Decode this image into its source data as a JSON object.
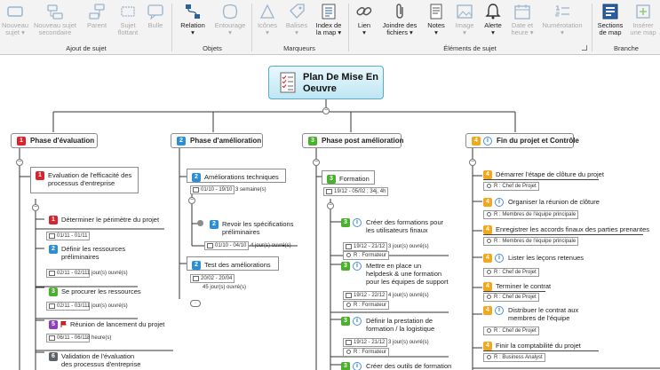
{
  "ribbon": {
    "buttons": [
      {
        "id": "nouveau-sujet",
        "label1": "Nouveau",
        "label2": "sujet ▾",
        "enabled": false,
        "icon": "new-topic-icon"
      },
      {
        "id": "nouveau-sujet-secondaire",
        "label1": "Nouveau sujet",
        "label2": "secondaire",
        "enabled": false,
        "icon": "new-subtopic-icon"
      },
      {
        "id": "parent",
        "label1": "Parent",
        "label2": "",
        "enabled": false,
        "icon": "parent-icon"
      },
      {
        "id": "sujet-flottant",
        "label1": "Sujet",
        "label2": "flottant",
        "enabled": false,
        "icon": "floating-topic-icon"
      },
      {
        "id": "bulle",
        "label1": "Bulle",
        "label2": "",
        "enabled": false,
        "icon": "bubble-icon"
      },
      {
        "id": "relation",
        "label1": "Relation",
        "label2": "▾",
        "enabled": true,
        "icon": "relation-icon"
      },
      {
        "id": "entourage",
        "label1": "Entourage",
        "label2": "▾",
        "enabled": false,
        "icon": "boundary-icon"
      },
      {
        "id": "icones",
        "label1": "Icônes",
        "label2": "▾",
        "enabled": false,
        "icon": "icons-icon"
      },
      {
        "id": "balises",
        "label1": "Balises",
        "label2": "▾",
        "enabled": false,
        "icon": "tags-icon"
      },
      {
        "id": "index-map",
        "label1": "Index de",
        "label2": "la map ▾",
        "enabled": true,
        "icon": "map-index-icon"
      },
      {
        "id": "lien",
        "label1": "Lien",
        "label2": "▾",
        "enabled": true,
        "icon": "link-icon"
      },
      {
        "id": "joindre",
        "label1": "Joindre des",
        "label2": "fichiers ▾",
        "enabled": true,
        "icon": "attach-icon"
      },
      {
        "id": "notes",
        "label1": "Notes",
        "label2": "▾",
        "enabled": true,
        "icon": "notes-icon"
      },
      {
        "id": "image",
        "label1": "Image",
        "label2": "▾",
        "enabled": false,
        "icon": "image-icon"
      },
      {
        "id": "alerte",
        "label1": "Alerte",
        "label2": "▾",
        "enabled": true,
        "icon": "alert-icon"
      },
      {
        "id": "date-heure",
        "label1": "Date et",
        "label2": "heure ▾",
        "enabled": false,
        "icon": "datetime-icon"
      },
      {
        "id": "numerotation",
        "label1": "Numérotation",
        "label2": "▾",
        "enabled": false,
        "icon": "numbering-icon"
      },
      {
        "id": "sections-map",
        "label1": "Sections",
        "label2": "de map",
        "enabled": true,
        "icon": "map-sections-icon"
      },
      {
        "id": "inserer-map",
        "label1": "Insérer",
        "label2": "une map",
        "enabled": false,
        "icon": "insert-map-icon"
      }
    ],
    "groups": {
      "ajout": "Ajout de sujet",
      "objets": "Objets",
      "marqueurs": "Marqueurs",
      "elements": "Éléments de sujet",
      "branche": "Branche"
    },
    "colors": {
      "accent": "#2b5f9e",
      "disabled": "#a9a9a9"
    }
  },
  "map": {
    "root": "Plan De Mise En Oeuvre",
    "phases": [
      {
        "num": "1",
        "title": "Phase d'évaluation",
        "task": {
          "num": "1",
          "text": "Evaluation de l'efficacité des processus d'entreprise"
        },
        "items": [
          {
            "num": "1",
            "text": "Déterminer le périmètre du projet",
            "date": "01/11 - 01/11"
          },
          {
            "num": "2",
            "text": "Définir les ressources préliminaires",
            "date": "02/11 - 02/11",
            "dur": "1 jour(s) ouvré(s)"
          },
          {
            "num": "3",
            "text": "Se procurer les ressources",
            "date": "02/11 - 03/11",
            "dur": "1 jour(s) ouvré(s)"
          },
          {
            "num": "5",
            "text": "Réunion de lancement du projet",
            "date": "06/11 - 06/11",
            "dur": "8 heure(s)"
          },
          {
            "num": "6",
            "text": "Validation de l'évaluation des processus d'entreprise"
          }
        ]
      },
      {
        "num": "2",
        "title": "Phase d'amélioration",
        "task": {
          "num": "2",
          "text": "Améliorations techniques",
          "date": "01/10 - 19/10",
          "dur": "3 semaine(s)"
        },
        "items": [
          {
            "num": "2",
            "text": "Revoir les spécifications préliminaires",
            "date": "01/10 - 04/10",
            "dur": "4 jour(s) ouvré(s)"
          }
        ],
        "task2": {
          "num": "2",
          "text": "Test des améliorations",
          "date": "20/02 - 20/04",
          "dur": "45 jour(s) ouvré(s)"
        }
      },
      {
        "num": "3",
        "title": "Phase post amélioration",
        "task": {
          "num": "3",
          "text": "Formation",
          "date": "19/12 - 05/02",
          "dur": "34j, 4h"
        },
        "items": [
          {
            "num": "3",
            "text": "Créer des formations pour les utilisateurs finaux",
            "date": "19/12 - 21/12",
            "dur": "3 jour(s) ouvré(s)",
            "res": "R : Formateur"
          },
          {
            "num": "3",
            "text": "Mettre en place un helpdesk & une formation pour les équipes de support",
            "date": "19/12 - 22/12",
            "dur": "4 jour(s) ouvré(s)",
            "res": "R : Formateur"
          },
          {
            "num": "3",
            "text": "Définir la prestation de formation / la logistique",
            "date": "19/12 - 21/12",
            "dur": "3 jour(s) ouvré(s)",
            "res": "R : Formateur"
          },
          {
            "num": "3",
            "text": "Créer des outils de formation"
          }
        ]
      },
      {
        "num": "4",
        "title": "Fin du projet  et Contrôle",
        "items": [
          {
            "num": "4",
            "text": "Démarrer l'étape de clôture du projet",
            "res": "R : Chef de Projet"
          },
          {
            "num": "4",
            "text": "Organiser la réunion de clôture",
            "res": "R : Membres de l'équipe principale"
          },
          {
            "num": "4",
            "text": "Enregistrer les accords finaux des parties prenantes",
            "res": "R : Membres de l'équipe principale"
          },
          {
            "num": "4",
            "text": "Lister les leçons retenues",
            "res": "R : Chef de Projet"
          },
          {
            "num": "4",
            "text": "Terminer le contrat",
            "res": "R : Chef de Projet"
          },
          {
            "num": "4",
            "text": "Distribuer le contrat aux membres de l'équipe",
            "res": "R : Chef de Projet"
          },
          {
            "num": "4",
            "text": "Finir la comptabilité du projet",
            "res": "R : Business Analyst"
          }
        ]
      }
    ]
  }
}
